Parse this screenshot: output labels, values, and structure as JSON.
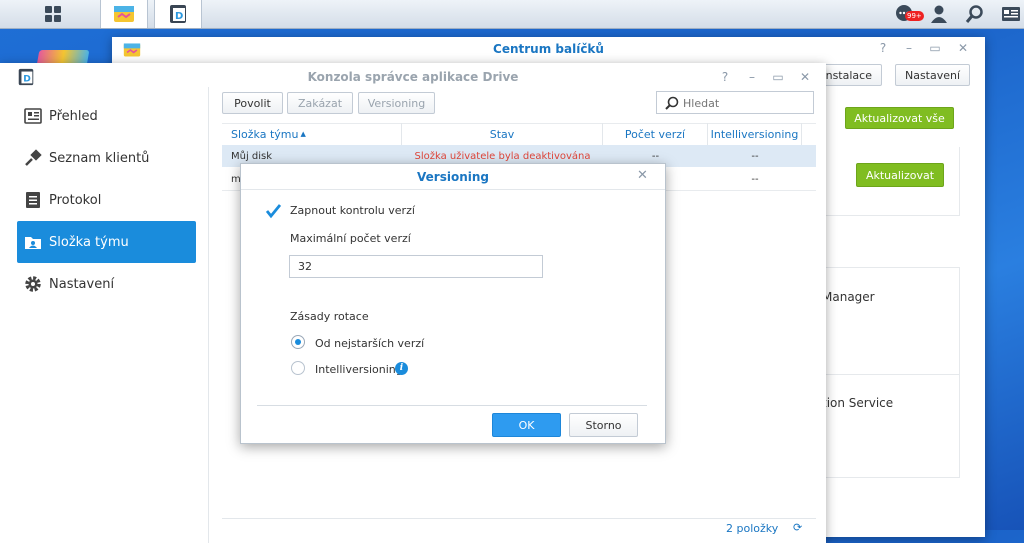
{
  "taskbar": {
    "apps": [
      {
        "name": "main-menu-icon"
      },
      {
        "name": "package-center-icon"
      },
      {
        "name": "drive-icon"
      }
    ],
    "notifications_badge": "99+"
  },
  "package_center": {
    "title": "Centrum balíčků",
    "manual_install_label": "ní instalace",
    "settings_label": "Nastavení",
    "update_all_label": "Aktualizovat vše",
    "update_label": "Aktualizovat",
    "item_partial_1": "Manager",
    "item_partial_2": "tion Service"
  },
  "drive_console": {
    "title": "Konzola správce aplikace Drive",
    "sidebar": [
      {
        "label": "Přehled",
        "icon": "overview-icon"
      },
      {
        "label": "Seznam klientů",
        "icon": "clients-icon"
      },
      {
        "label": "Protokol",
        "icon": "log-icon"
      },
      {
        "label": "Složka týmu",
        "icon": "team-folder-icon",
        "active": true
      },
      {
        "label": "Nastavení",
        "icon": "gear-icon"
      }
    ],
    "toolbar": {
      "enable_label": "Povolit",
      "disable_label": "Zakázat",
      "versioning_label": "Versioning",
      "search_placeholder": "Hledat"
    },
    "table": {
      "columns": [
        "Složka týmu",
        "Stav",
        "Počet verzí",
        "Intelliversioning"
      ],
      "rows": [
        {
          "folder": "Můj disk",
          "status": "Složka uživatele byla deaktivována",
          "versions": "--",
          "intelli": "--"
        },
        {
          "folder": "m",
          "status": "",
          "versions": "",
          "intelli": "--"
        }
      ]
    },
    "footer_count": "2 položky"
  },
  "dialog": {
    "title": "Versioning",
    "enable_versioning_label": "Zapnout kontrolu verzí",
    "enable_versioning_checked": true,
    "max_versions_label": "Maximální počet verzí",
    "max_versions_value": "32",
    "rotation_label": "Zásady rotace",
    "rotation_options": [
      {
        "label": "Od nejstarších verzí",
        "selected": true
      },
      {
        "label": "Intelliversioning",
        "selected": false
      }
    ],
    "ok_label": "OK",
    "cancel_label": "Storno"
  },
  "colors": {
    "accent": "#1a8cdc",
    "green_button": "#80bd21",
    "error_text": "#e0463a",
    "header_text": "#1a76c2"
  }
}
